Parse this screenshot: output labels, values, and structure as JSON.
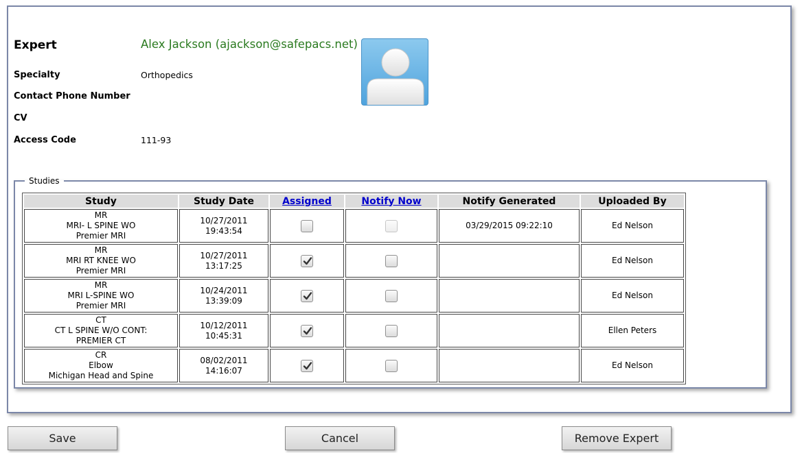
{
  "expert": {
    "heading": "Expert",
    "name": "Alex Jackson (ajackson@safepacs.net)",
    "fields": {
      "specialty_label": "Specialty",
      "specialty_value": "Orthopedics",
      "phone_label": "Contact Phone Number",
      "phone_value": "",
      "cv_label": "CV",
      "cv_value": "",
      "access_label": "Access Code",
      "access_value": "111-93"
    },
    "avatar_icon": "user-silhouette-icon"
  },
  "studies": {
    "legend": "Studies",
    "headers": {
      "study": "Study",
      "study_date": "Study Date",
      "assigned": "Assigned",
      "notify_now": "Notify Now",
      "notify_generated": "Notify Generated",
      "uploaded_by": "Uploaded By"
    },
    "rows": [
      {
        "l1": "MR",
        "l2": "MRI- L SPINE WO",
        "l3": "Premier MRI",
        "date": "10/27/2011",
        "time": "19:43:54",
        "assigned": false,
        "notify_now": false,
        "notify_disabled": true,
        "notify_generated": "03/29/2015 09:22:10",
        "uploaded_by": "Ed Nelson"
      },
      {
        "l1": "MR",
        "l2": "MRI RT KNEE WO",
        "l3": "Premier MRI",
        "date": "10/27/2011",
        "time": "13:17:25",
        "assigned": true,
        "notify_now": false,
        "notify_disabled": false,
        "notify_generated": "",
        "uploaded_by": "Ed Nelson"
      },
      {
        "l1": "MR",
        "l2": "MRI L-SPINE WO",
        "l3": "Premier MRI",
        "date": "10/24/2011",
        "time": "13:39:09",
        "assigned": true,
        "notify_now": false,
        "notify_disabled": false,
        "notify_generated": "",
        "uploaded_by": "Ed Nelson"
      },
      {
        "l1": "CT",
        "l2": "CT L SPINE W/O CONT:",
        "l3": "PREMIER CT",
        "date": "10/12/2011",
        "time": "10:45:31",
        "assigned": true,
        "notify_now": false,
        "notify_disabled": false,
        "notify_generated": "",
        "uploaded_by": "Ellen Peters"
      },
      {
        "l1": "CR",
        "l2": "Elbow",
        "l3": "Michigan Head and Spine",
        "date": "08/02/2011",
        "time": "14:16:07",
        "assigned": true,
        "notify_now": false,
        "notify_disabled": false,
        "notify_generated": "",
        "uploaded_by": "Ed Nelson"
      }
    ]
  },
  "buttons": {
    "save": "Save",
    "cancel": "Cancel",
    "remove": "Remove Expert"
  },
  "colors": {
    "expert_name": "#2a7a1f",
    "link": "#0000cc",
    "panel_border": "#7b87a8"
  }
}
